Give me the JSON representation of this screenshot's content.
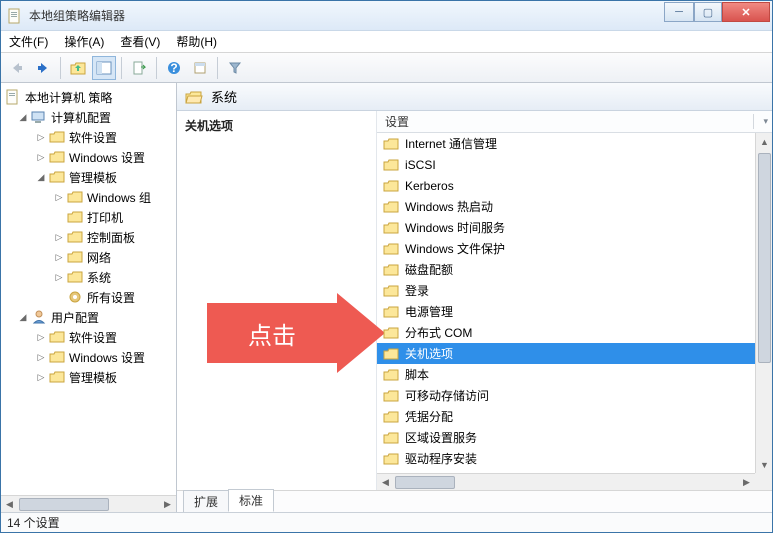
{
  "window": {
    "title": "本地组策略编辑器"
  },
  "menu": {
    "file": "文件(F)",
    "action": "操作(A)",
    "view": "查看(V)",
    "help": "帮助(H)"
  },
  "tree": {
    "root": "本地计算机 策略",
    "computer": "计算机配置",
    "software": "软件设置",
    "windows_settings": "Windows 设置",
    "admin_templates": "管理模板",
    "windows_comp": "Windows 组",
    "printers": "打印机",
    "control_panel": "控制面板",
    "network": "网络",
    "system": "系统",
    "all_settings": "所有设置",
    "user": "用户配置",
    "u_software": "软件设置",
    "u_windows": "Windows 设置",
    "u_admin": "管理模板"
  },
  "header": {
    "path": "系统"
  },
  "leftcol": {
    "title": "关机选项"
  },
  "listheader": {
    "col": "设置"
  },
  "items": [
    "Internet 通信管理",
    "iSCSI",
    "Kerberos",
    "Windows 热启动",
    "Windows 时间服务",
    "Windows 文件保护",
    "磁盘配额",
    "登录",
    "电源管理",
    "分布式 COM",
    "关机选项",
    "脚本",
    "可移动存储访问",
    "凭据分配",
    "区域设置服务",
    "驱动程序安装"
  ],
  "selected_index": 10,
  "tabs": {
    "ext": "扩展",
    "std": "标准"
  },
  "status": "14 个设置",
  "annot": "点击"
}
